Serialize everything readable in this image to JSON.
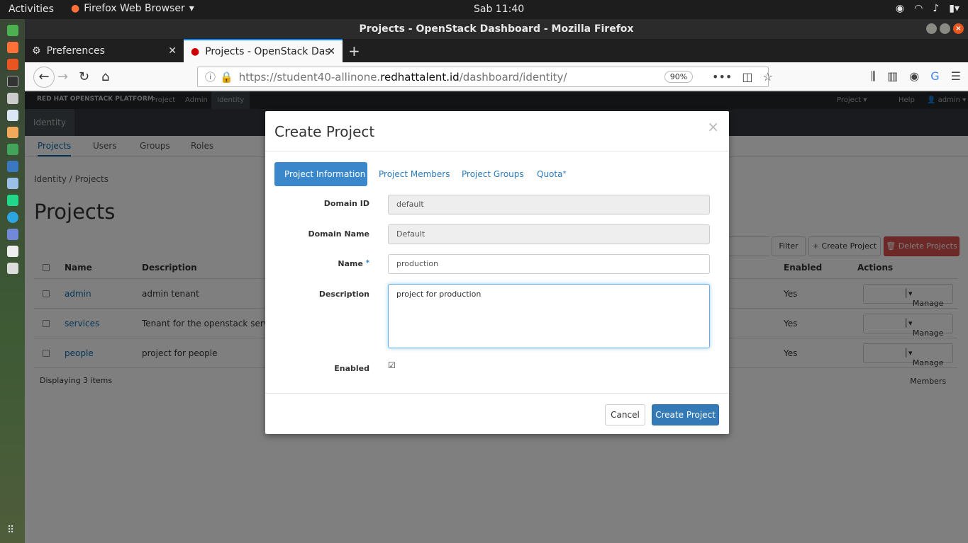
{
  "system": {
    "activities": "Activities",
    "app_menu": "Firefox Web Browser",
    "clock": "Sab 11:40"
  },
  "window": {
    "title": "Projects - OpenStack Dashboard - Mozilla Firefox"
  },
  "tabs": [
    {
      "label": "Preferences"
    },
    {
      "label": "Projects - OpenStack Das"
    }
  ],
  "url": {
    "prefix": "https://student40-allinone.",
    "domain": "redhattalent.id",
    "suffix": "/dashboard/identity/",
    "zoom": "90%"
  },
  "openstack": {
    "brand": "RED HAT OPENSTACK PLATFORM",
    "menus": [
      "Project",
      "Admin",
      "Identity"
    ],
    "right_menus": [
      "Project",
      "Help",
      "admin"
    ],
    "panel": "Identity",
    "tabs": [
      "Projects",
      "Users",
      "Groups",
      "Roles"
    ],
    "breadcrumb": "Identity  /  Projects",
    "page_title": "Projects",
    "filter_btn": "Filter",
    "create_btn": "Create Project",
    "delete_btn": "Delete Projects",
    "columns": [
      "Name",
      "Description",
      "Enabled",
      "Actions"
    ],
    "rows": [
      {
        "name": "admin",
        "description": "admin tenant",
        "enabled": "Yes",
        "action": "Manage Members"
      },
      {
        "name": "services",
        "description": "Tenant for the openstack services",
        "enabled": "Yes",
        "action": "Manage Members"
      },
      {
        "name": "people",
        "description": "project for people",
        "enabled": "Yes",
        "action": "Manage Members"
      }
    ],
    "footer": "Displaying 3 items"
  },
  "modal": {
    "title": "Create Project",
    "close": "×",
    "tabs": [
      "Project Information",
      "Project Members",
      "Project Groups",
      "Quota"
    ],
    "required_mark": "*",
    "fields": {
      "domain_id_label": "Domain ID",
      "domain_id": "default",
      "domain_name_label": "Domain Name",
      "domain_name": "Default",
      "name_label": "Name",
      "name": "production",
      "description_label": "Description",
      "description": "project for production",
      "enabled_label": "Enabled"
    },
    "cancel": "Cancel",
    "submit": "Create Project"
  }
}
